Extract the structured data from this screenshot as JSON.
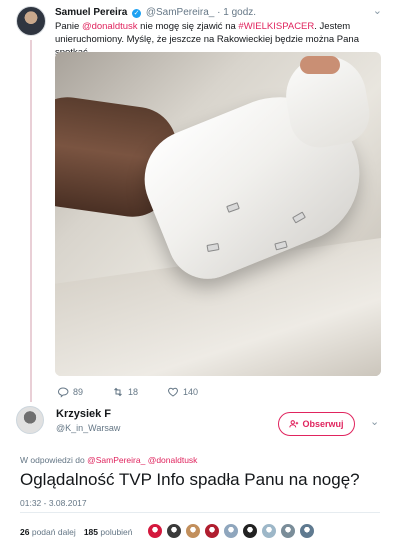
{
  "tweet1": {
    "display_name": "Samuel Pereira",
    "handle": "@SamPereira_",
    "time": "· 1 godz.",
    "text_parts": {
      "pre": "Panie ",
      "mention": "@donaldtusk",
      "mid": " nie mogę się zjawić na ",
      "hashtag": "#WIELKISPACER",
      "post": ". Jestem unieruchomiony. Myślę, że jeszcze na Rakowieckiej będzie można Pana spotkać."
    },
    "actions": {
      "replies": "89",
      "retweets": "18",
      "likes": "140"
    },
    "icons": {
      "caret": "chevron-down-icon",
      "verified": "verified-badge-icon",
      "reply": "reply-icon",
      "retweet": "retweet-icon",
      "like": "heart-icon"
    }
  },
  "tweet2": {
    "display_name": "Krzysiek F",
    "handle": "@K_in_Warsaw",
    "follow_label": "Obserwuj",
    "reply_prefix": "W odpowiedzi do ",
    "reply_to": "@SamPereira_ @donaldtusk",
    "text": "Oglądalność TVP Info spadła Panu na nogę?",
    "timestamp": "01:32 - 3.08.2017",
    "retweet_count": "26",
    "retweet_label": "podań dalej",
    "like_count": "185",
    "like_label": "polubień",
    "liker_colors": [
      "#d4183d",
      "#3a3a3a",
      "#c28f5c",
      "#b01e2f",
      "#8fa6bd",
      "#222222",
      "#9db7c8",
      "#7a8d99",
      "#5f7a90"
    ]
  },
  "colors": {
    "accent": "#e0245e",
    "verified": "#1da1f2",
    "muted": "#657786"
  }
}
